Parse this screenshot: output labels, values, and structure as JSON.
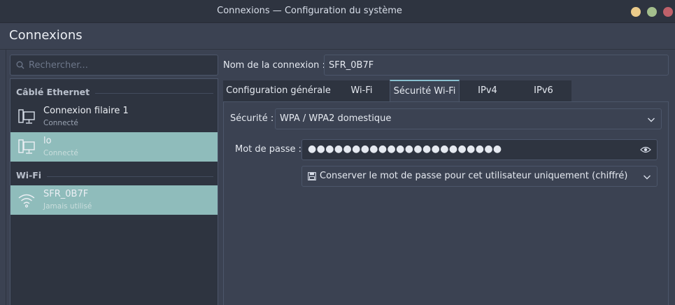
{
  "window": {
    "title": "Connexions — Configuration du système",
    "controls": [
      "minimize",
      "maximize",
      "close"
    ]
  },
  "header": {
    "title": "Connexions"
  },
  "search": {
    "placeholder": "Rechercher..."
  },
  "sections": [
    {
      "label": "Câblé Ethernet",
      "items": [
        {
          "name": "Connexion filaire 1",
          "status": "Connecté",
          "icon": "wired-network-icon",
          "selected": false
        },
        {
          "name": "lo",
          "status": "Connecté",
          "icon": "wired-network-icon",
          "selected": true
        }
      ]
    },
    {
      "label": "Wi-Fi",
      "items": [
        {
          "name": "SFR_0B7F",
          "status": "Jamais utilisé",
          "icon": "wifi-icon",
          "selected": true
        }
      ]
    }
  ],
  "connection": {
    "name_label": "Nom de la connexion :",
    "name_value": "SFR_0B7F"
  },
  "tabs": [
    {
      "label": "Configuration générale",
      "active": false
    },
    {
      "label": "Wi-Fi",
      "active": false
    },
    {
      "label": "Sécurité Wi-Fi",
      "active": true
    },
    {
      "label": "IPv4",
      "active": false
    },
    {
      "label": "IPv6",
      "active": false
    }
  ],
  "security": {
    "label": "Sécurité :",
    "value": "WPA / WPA2 domestique",
    "password_label": "Mot de passe :",
    "password_mask": "●●●●●●●●●●●●●●●●●●●●●●",
    "store_option": "Conserver le mot de passe pour cet utilisateur uniquement (chiffré)"
  },
  "colors": {
    "background": "#3b4252",
    "dark": "#2e3440",
    "selection": "#8fbcbb",
    "accent": "#88c0d0",
    "border": "#4c566a"
  }
}
